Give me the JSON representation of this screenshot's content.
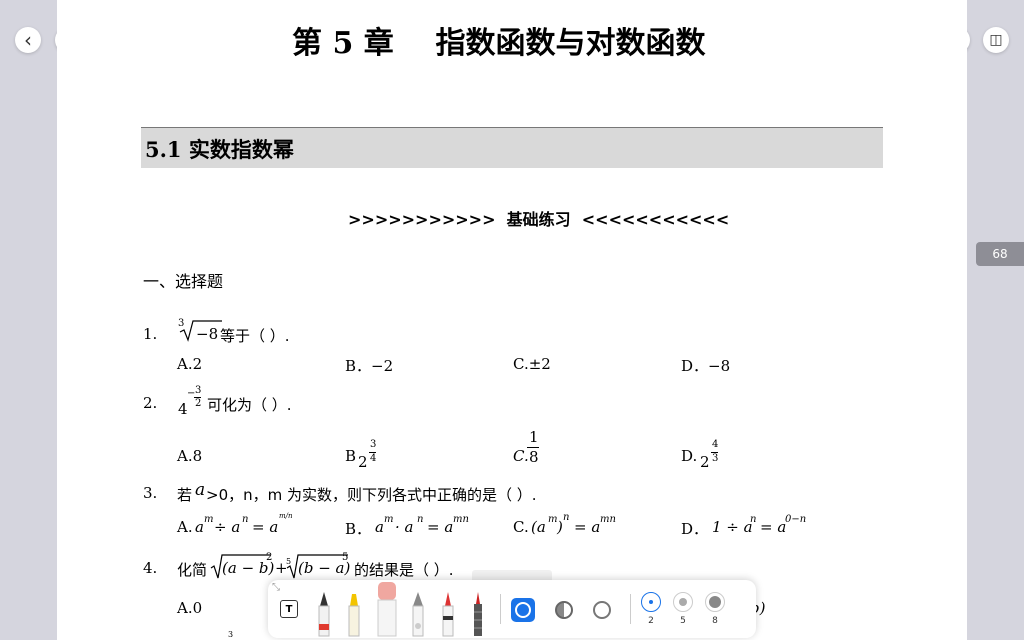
{
  "nav": {
    "back_icon": "‹",
    "outline_icon": "▤",
    "grid_icon": "⊞",
    "undo_icon": "↶",
    "redo_icon": "↷",
    "more_icon": "•••",
    "panel_icon": "◫"
  },
  "chapter_title": "第 5 章    指数函数与对数函数",
  "section_title": "5.1 实数指数幂",
  "practice_heading": ">>>>>>>>>>>  基础练习  <<<<<<<<<<<",
  "part_title": "一、选择题",
  "page_number": "68",
  "questions": [
    {
      "num": "1.",
      "text_after": "等于（   ）.",
      "radical_index": "3",
      "radicand": "−8",
      "options": {
        "a": "A.2",
        "b": "B．−2",
        "c": "C.±2",
        "d": "D．−8"
      }
    },
    {
      "num": "2.",
      "base": "4",
      "exp_sign": "−",
      "exp_num": "3",
      "exp_den": "2",
      "text_after": "可化为（   ）.",
      "options": {
        "a": "A.8",
        "b_prefix": "B",
        "b_base": "2",
        "b_num": "3",
        "b_den": "4",
        "c_prefix": "C.",
        "c_num": "1",
        "c_den": "8",
        "d_prefix": "D.",
        "d_base": "2",
        "d_num": "4",
        "d_den": "3"
      }
    },
    {
      "num": "3.",
      "text_before": "若",
      "var_a": "a",
      "text_after": ">0，n，m 为实数，则下列各式中正确的是（   ）.",
      "options": {
        "a_prefix": "A.",
        "a_expr": "a",
        "a_m": "m",
        "a_op": "÷ a",
        "a_n": "n",
        "a_eq": "= a",
        "a_frac": "m/n",
        "b_prefix": "B．",
        "b_expr": "a",
        "b_m": "m",
        "b_op": "· a",
        "b_n": "n",
        "b_eq": "= a",
        "b_exp": "mn",
        "c_prefix": "C.",
        "c_expr": "(a",
        "c_m": "m",
        "c_close": ")",
        "c_n": "n",
        "c_eq": "= a",
        "c_exp": "mn",
        "d_prefix": "D．",
        "d_expr": "1 ÷ a",
        "d_n": "n",
        "d_eq": "= a",
        "d_exp": "0−n"
      }
    },
    {
      "num": "4.",
      "text_before": "化简",
      "expr1": "(a − b)",
      "exp1": "2",
      "plus": "+",
      "root_idx": "5",
      "expr2": "(b − a)",
      "exp2": "5",
      "text_after": "的结果是（   ）.",
      "options": {
        "a": "A.0",
        "d_tail": "b)"
      }
    }
  ],
  "footer_superscript": "3",
  "toolbar": {
    "text_tool_icon": "T",
    "color_modes": [
      "blue-fill-mode",
      "gray-half-mode",
      "empty-mode"
    ],
    "sizes": [
      "2",
      "5",
      "8"
    ],
    "active_size_index": 0
  },
  "colors": {
    "accent": "#1a73e8",
    "section_bg": "#d9d9d9",
    "background": "#d5d5de",
    "badge": "#8e8e96"
  }
}
